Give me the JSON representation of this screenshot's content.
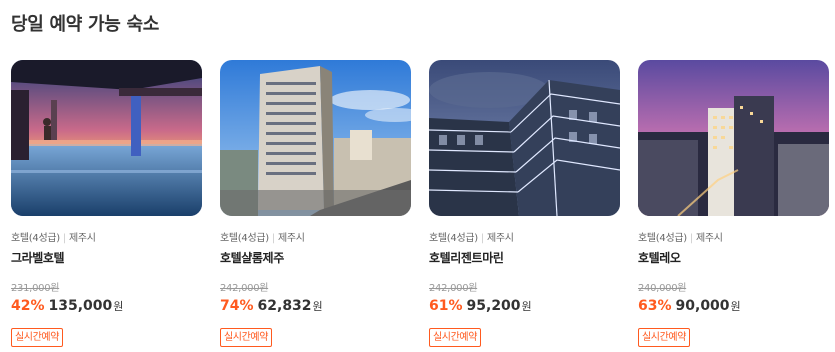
{
  "section": {
    "title": "당일 예약 가능 숙소"
  },
  "hotels": [
    {
      "type": "호텔(4성급)",
      "region": "제주시",
      "name": "그라벨호텔",
      "original_price": "231,000원",
      "discount": "42%",
      "price": "135,000",
      "currency": "원",
      "badge": "실시간예약"
    },
    {
      "type": "호텔(4성급)",
      "region": "제주시",
      "name": "호텔샬롬제주",
      "original_price": "242,000원",
      "discount": "74%",
      "price": "62,832",
      "currency": "원",
      "badge": "실시간예약"
    },
    {
      "type": "호텔(4성급)",
      "region": "제주시",
      "name": "호텔리젠트마린",
      "original_price": "242,000원",
      "discount": "61%",
      "price": "95,200",
      "currency": "원",
      "badge": "실시간예약"
    },
    {
      "type": "호텔(4성급)",
      "region": "제주시",
      "name": "호텔레오",
      "original_price": "240,000원",
      "discount": "63%",
      "price": "90,000",
      "currency": "원",
      "badge": "실시간예약"
    }
  ],
  "colors": {
    "accent": "#ff5a1f",
    "text": "#222222",
    "muted": "#999999"
  }
}
